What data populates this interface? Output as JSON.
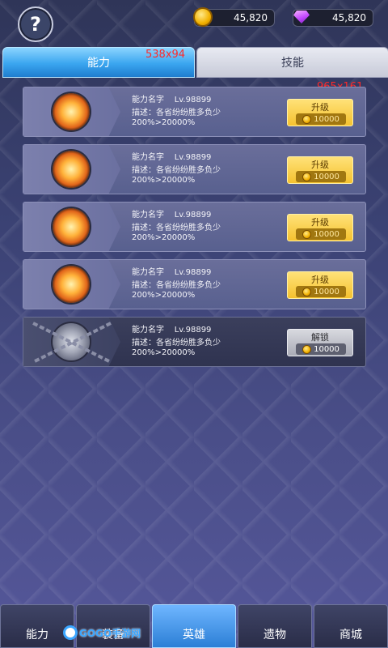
{
  "header": {
    "help_icon": "question-mark-icon",
    "help_glyph": "?",
    "gold": "45,820",
    "gems": "45,820"
  },
  "tabs": [
    {
      "label": "能力",
      "active": true
    },
    {
      "label": "技能",
      "active": false
    }
  ],
  "debug_tags": [
    "538x94",
    "965x161"
  ],
  "cards": [
    {
      "name": "能力名字",
      "level": "Lv.98899",
      "desc": "描述：各省纷纷胜多负少",
      "stat": "200%>20000%",
      "button": "升级",
      "cost": "10000",
      "locked": false
    },
    {
      "name": "能力名字",
      "level": "Lv.98899",
      "desc": "描述：各省纷纷胜多负少",
      "stat": "200%>20000%",
      "button": "升级",
      "cost": "10000",
      "locked": false
    },
    {
      "name": "能力名字",
      "level": "Lv.98899",
      "desc": "描述：各省纷纷胜多负少",
      "stat": "200%>20000%",
      "button": "升级",
      "cost": "10000",
      "locked": false
    },
    {
      "name": "能力名字",
      "level": "Lv.98899",
      "desc": "描述：各省纷纷胜多负少",
      "stat": "200%>20000%",
      "button": "升级",
      "cost": "10000",
      "locked": false
    },
    {
      "name": "能力名字",
      "level": "Lv.98899",
      "desc": "描述：各省纷纷胜多负少",
      "stat": "200%>20000%",
      "button": "解锁",
      "cost": "10000",
      "locked": true
    }
  ],
  "bottom_nav": [
    {
      "label": "能力",
      "active": false
    },
    {
      "label": "装备",
      "active": false
    },
    {
      "label": "英雄",
      "active": true
    },
    {
      "label": "遗物",
      "active": false
    },
    {
      "label": "商城",
      "active": false
    }
  ],
  "watermark": "GOGO手游网"
}
